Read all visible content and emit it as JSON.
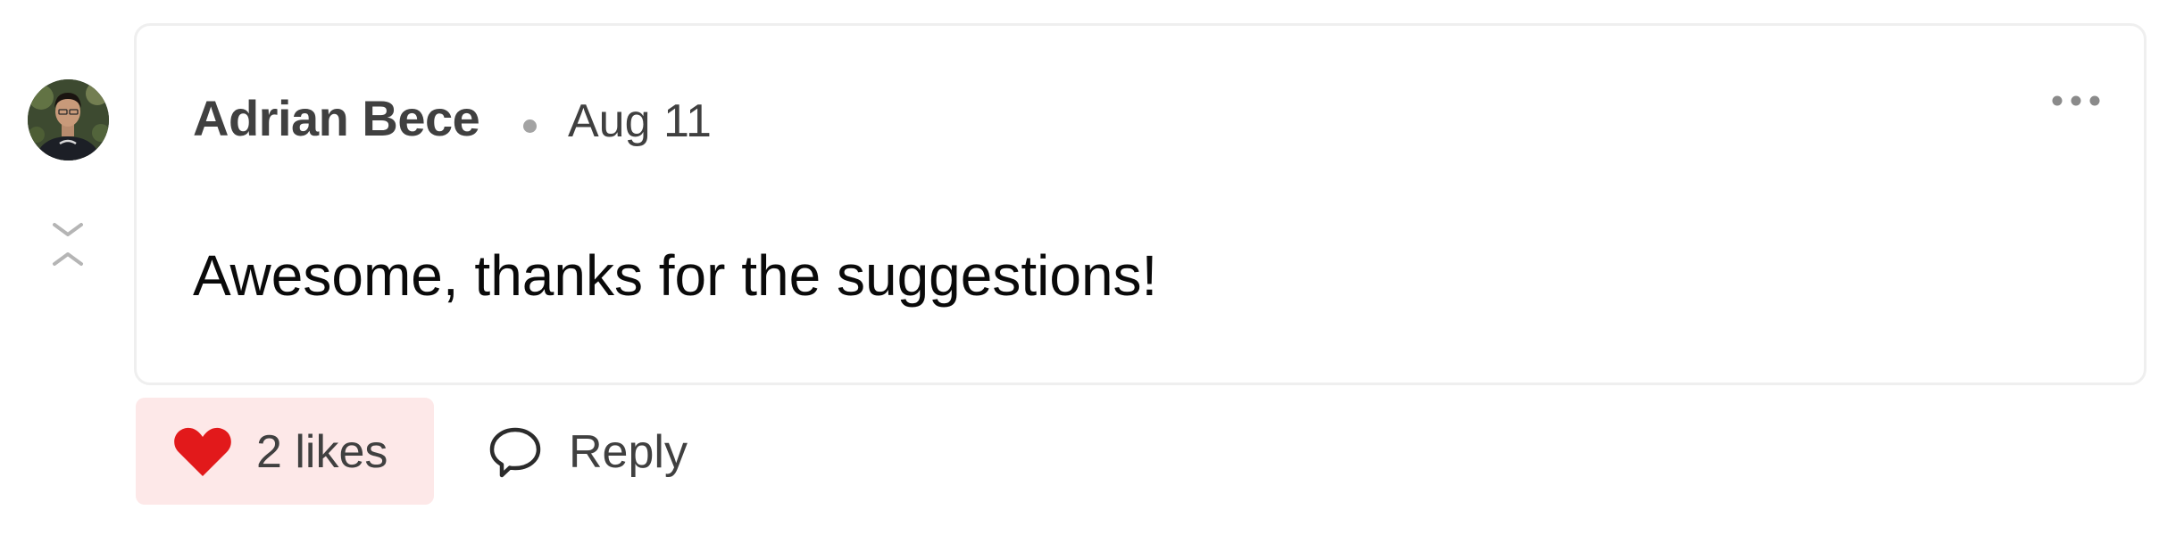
{
  "comment": {
    "author": "Adrian Bece",
    "date": "Aug 11",
    "body": "Awesome, thanks for the suggestions!",
    "avatar_icon": "user-avatar",
    "collapse_icon": "collapse-thread-icon",
    "more_icon": "more-options-icon"
  },
  "actions": {
    "like_label": "2 likes",
    "like_count": 2,
    "liked": true,
    "like_icon": "heart-icon",
    "reply_label": "Reply",
    "reply_icon": "comment-bubble-icon"
  },
  "colors": {
    "heart": "#e2191b",
    "like_background": "#fde8e8",
    "card_border": "#efefef",
    "muted_text": "#404040"
  }
}
